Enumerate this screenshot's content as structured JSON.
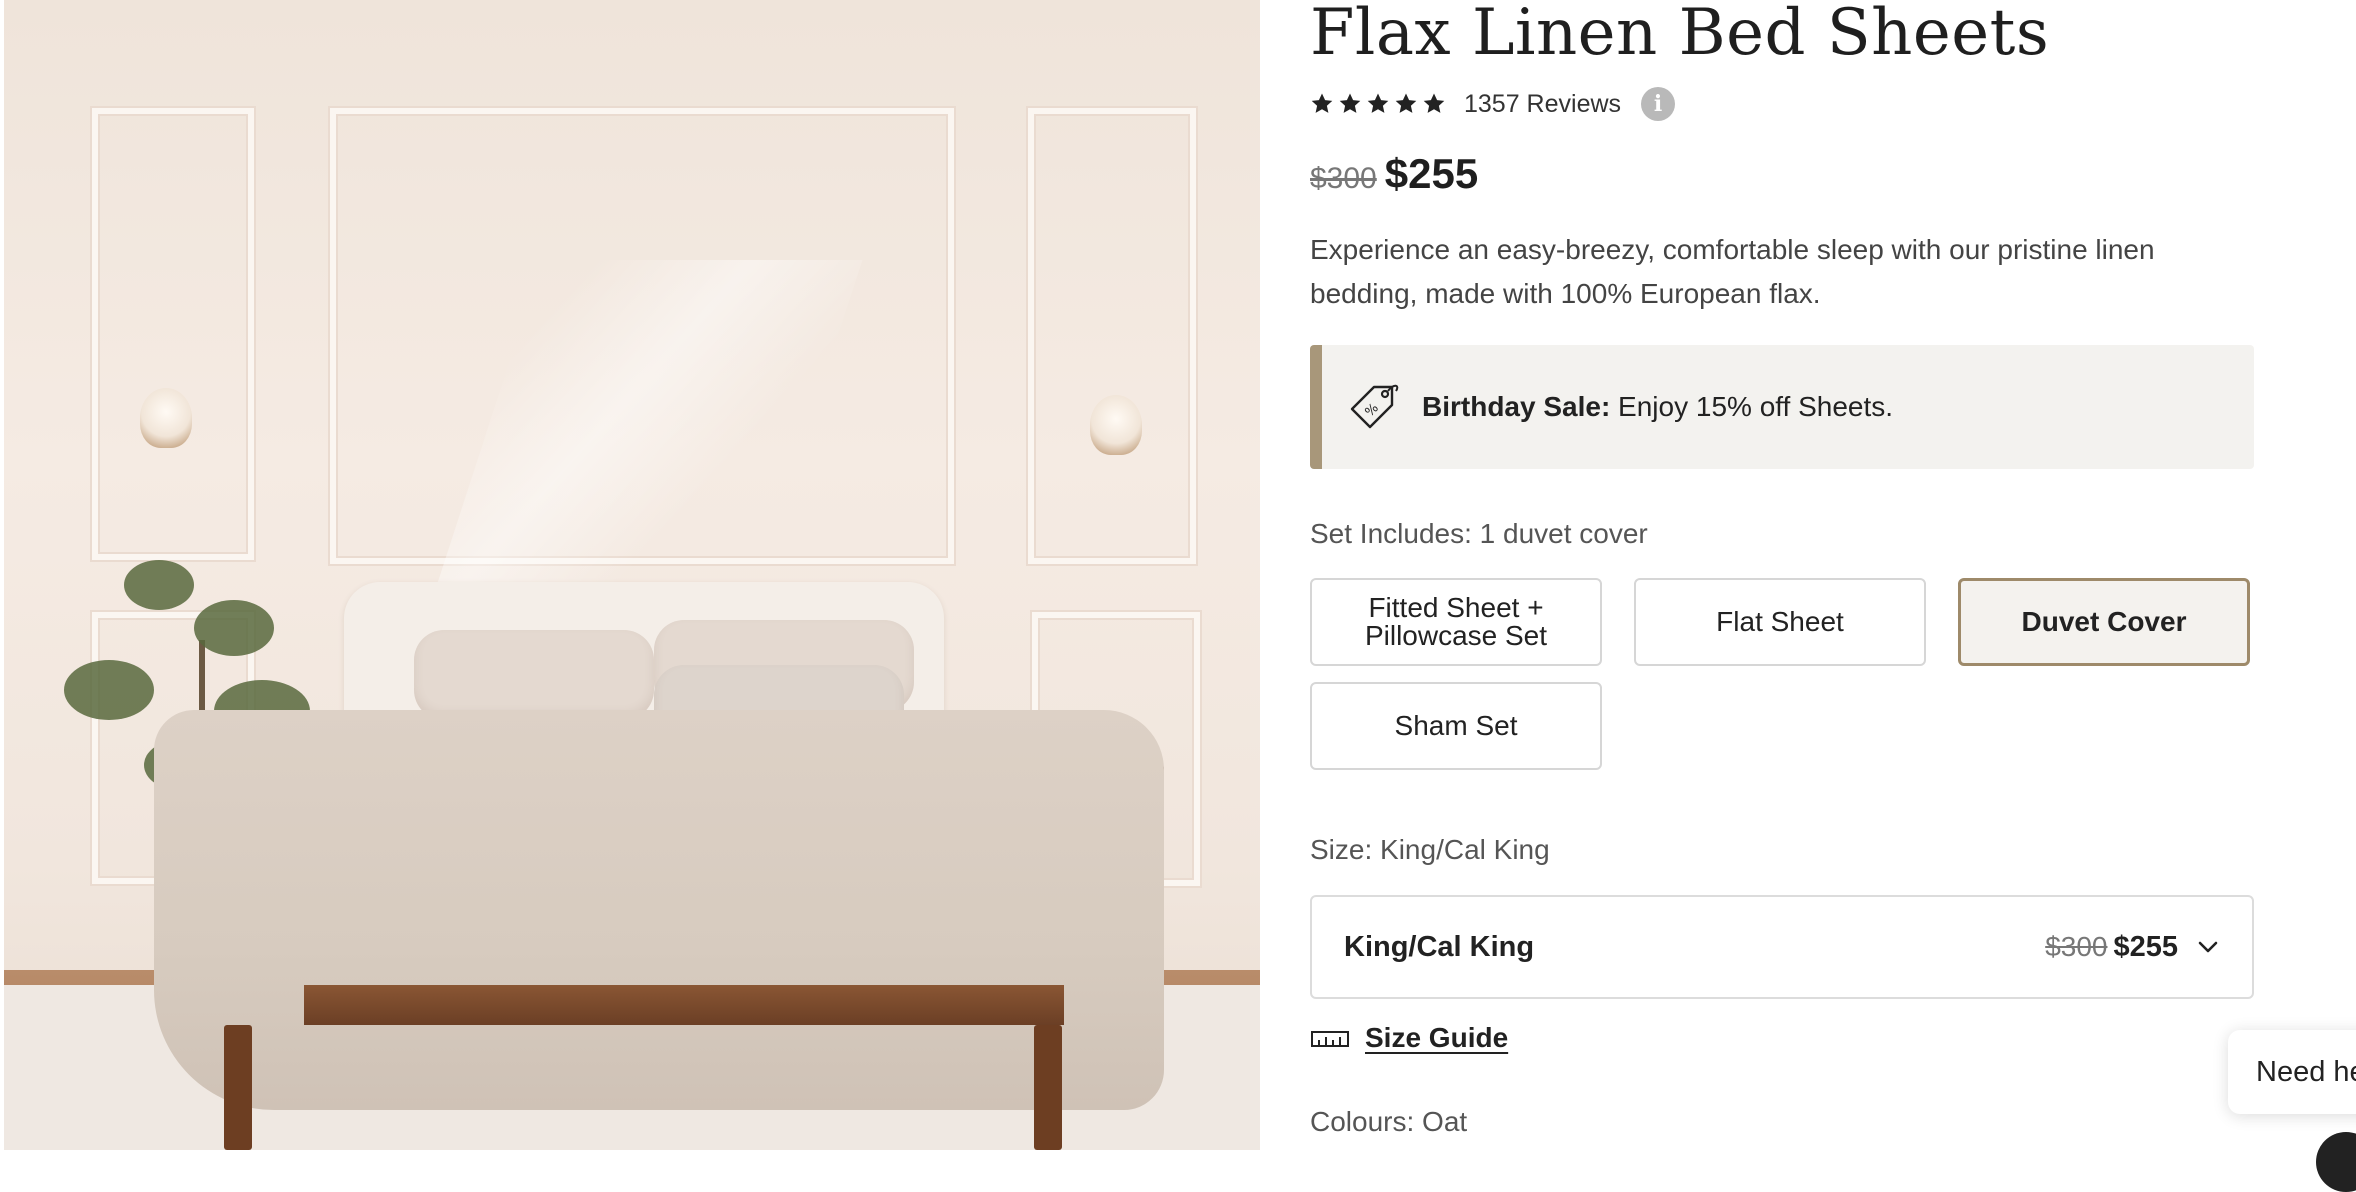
{
  "product": {
    "title": "Flax Linen Bed Sheets",
    "rating_stars": 5,
    "reviews_label": "1357 Reviews",
    "price_was": "$300",
    "price_now": "$255",
    "description": "Experience an easy-breezy, comfortable sleep with our pristine linen bedding, made with 100% European flax."
  },
  "promo": {
    "bold": "Birthday Sale:",
    "text": " Enjoy 15% off Sheets."
  },
  "set": {
    "label": "Set Includes: 1 duvet cover",
    "options": [
      {
        "line1": "Fitted Sheet +",
        "line2": "Pillowcase Set"
      },
      {
        "label": "Flat Sheet"
      },
      {
        "label": "Duvet Cover",
        "selected": true
      },
      {
        "label": "Sham Set"
      }
    ]
  },
  "size": {
    "label": "Size: King/Cal King",
    "selected": "King/Cal King",
    "price_was": "$300",
    "price_now": "$255"
  },
  "size_guide": {
    "label": "Size Guide"
  },
  "colours": {
    "label": "Colours: Oat"
  },
  "help": {
    "label": "Need help?"
  },
  "colors": {
    "accent": "#a8977a",
    "selected_border": "#9e8a6a",
    "promo_bg": "#f3f2ef"
  },
  "icons": [
    "star-icon",
    "info-icon",
    "price-tag-icon",
    "chevron-down-icon",
    "ruler-icon"
  ]
}
